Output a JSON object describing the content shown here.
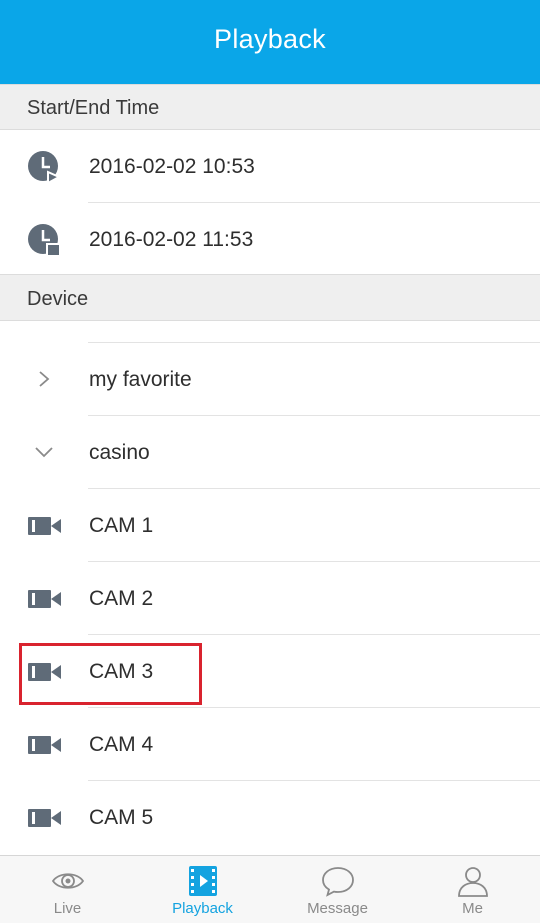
{
  "header": {
    "title": "Playback"
  },
  "sections": {
    "time": {
      "label": "Start/End Time"
    },
    "device": {
      "label": "Device"
    }
  },
  "times": {
    "start": "2016-02-02 10:53",
    "end": "2016-02-02 11:53"
  },
  "devices": {
    "groups": [
      {
        "label": "my favorite",
        "state": "collapsed"
      },
      {
        "label": "casino",
        "state": "expanded"
      }
    ],
    "cameras": [
      "CAM 1",
      "CAM 2",
      "CAM 3",
      "CAM 4",
      "CAM 5"
    ],
    "highlighted": "CAM 3"
  },
  "tabs": [
    {
      "label": "Live",
      "icon": "eye-icon"
    },
    {
      "label": "Playback",
      "icon": "playback-icon",
      "active": true
    },
    {
      "label": "Message",
      "icon": "speech-bubble-icon"
    },
    {
      "label": "Me",
      "icon": "person-icon"
    }
  ],
  "colors": {
    "header_bg": "#0aa6e8",
    "accent": "#14a3e0",
    "highlight_border": "#d9232e",
    "icon_gray": "#5f6b78"
  }
}
